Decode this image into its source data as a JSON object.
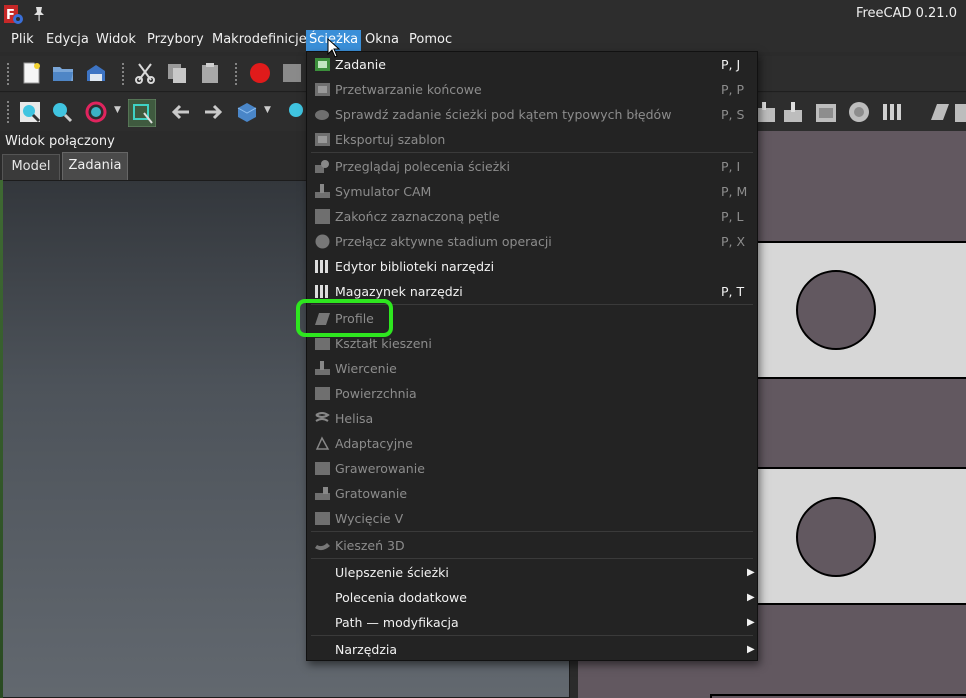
{
  "window": {
    "title": "FreeCAD 0.21.0"
  },
  "menubar": [
    {
      "name": "menu-plik",
      "label": "Plik",
      "active": false
    },
    {
      "name": "menu-edycja",
      "label": "Edycja",
      "active": false
    },
    {
      "name": "menu-widok",
      "label": "Widok",
      "active": false
    },
    {
      "name": "menu-przybory",
      "label": "Przybory",
      "active": false
    },
    {
      "name": "menu-makrodefinicje",
      "label": "Makrodefinicje",
      "active": false
    },
    {
      "name": "menu-sciezka",
      "label": "Ścieżka",
      "active": true
    },
    {
      "name": "menu-okna",
      "label": "Okna",
      "active": false
    },
    {
      "name": "menu-pomoc",
      "label": "Pomoc",
      "active": false
    }
  ],
  "combo": {
    "title": "Widok połączony",
    "tabs": [
      "Model",
      "Zadania"
    ]
  },
  "path_menu": {
    "items": [
      {
        "label": "Zadanie",
        "shortcut": "P, J",
        "enabled": true,
        "icon": "job-icon"
      },
      {
        "label": "Przetwarzanie końcowe",
        "shortcut": "P, P",
        "enabled": false,
        "icon": "post-process-icon"
      },
      {
        "label": "Sprawdź zadanie ścieżki pod kątem typowych błędów",
        "shortcut": "P, S",
        "enabled": false,
        "icon": "sanity-check-icon"
      },
      {
        "label": "Eksportuj szablon",
        "shortcut": "",
        "enabled": false,
        "icon": "export-template-icon"
      },
      {
        "label": "Przeglądaj polecenia ścieżki",
        "shortcut": "P, I",
        "enabled": false,
        "icon": "inspect-icon"
      },
      {
        "label": "Symulator CAM",
        "shortcut": "P, M",
        "enabled": false,
        "icon": "simulator-icon"
      },
      {
        "label": "Zakończ zaznaczoną pętle",
        "shortcut": "P, L",
        "enabled": false,
        "icon": "loop-icon"
      },
      {
        "label": "Przełącz aktywne stadium operacji",
        "shortcut": "P, X",
        "enabled": false,
        "icon": "toggle-active-icon"
      },
      {
        "label": "Edytor biblioteki narzędzi",
        "shortcut": "",
        "enabled": true,
        "icon": "tool-library-icon"
      },
      {
        "label": "Magazynek narzędzi",
        "shortcut": "P, T",
        "enabled": true,
        "icon": "tool-bit-icon"
      },
      {
        "label": "Profile",
        "shortcut": "",
        "enabled": false,
        "icon": "profile-icon"
      },
      {
        "label": "Kształt kieszeni",
        "shortcut": "",
        "enabled": false,
        "icon": "pocket-shape-icon"
      },
      {
        "label": "Wiercenie",
        "shortcut": "",
        "enabled": false,
        "icon": "drilling-icon"
      },
      {
        "label": "Powierzchnia",
        "shortcut": "",
        "enabled": false,
        "icon": "face-icon"
      },
      {
        "label": "Helisa",
        "shortcut": "",
        "enabled": false,
        "icon": "helix-icon"
      },
      {
        "label": "Adaptacyjne",
        "shortcut": "",
        "enabled": false,
        "icon": "adaptive-icon"
      },
      {
        "label": "Grawerowanie",
        "shortcut": "",
        "enabled": false,
        "icon": "engrave-icon"
      },
      {
        "label": "Gratowanie",
        "shortcut": "",
        "enabled": false,
        "icon": "deburr-icon"
      },
      {
        "label": "Wycięcie V",
        "shortcut": "",
        "enabled": false,
        "icon": "vcarve-icon"
      },
      {
        "label": "Kieszeń 3D",
        "shortcut": "",
        "enabled": false,
        "icon": "pocket-3d-icon"
      },
      {
        "label": "Ulepszenie ścieżki",
        "shortcut": "",
        "enabled": true,
        "icon": "",
        "submenu": true
      },
      {
        "label": "Polecenia dodatkowe",
        "shortcut": "",
        "enabled": true,
        "icon": "",
        "submenu": true
      },
      {
        "label": "Path — modyfikacja",
        "shortcut": "",
        "enabled": true,
        "icon": "",
        "submenu": true
      },
      {
        "label": "Narzędzia",
        "shortcut": "",
        "enabled": true,
        "icon": "",
        "submenu": true
      }
    ]
  },
  "annotation": {
    "color": "#2ee61f"
  }
}
